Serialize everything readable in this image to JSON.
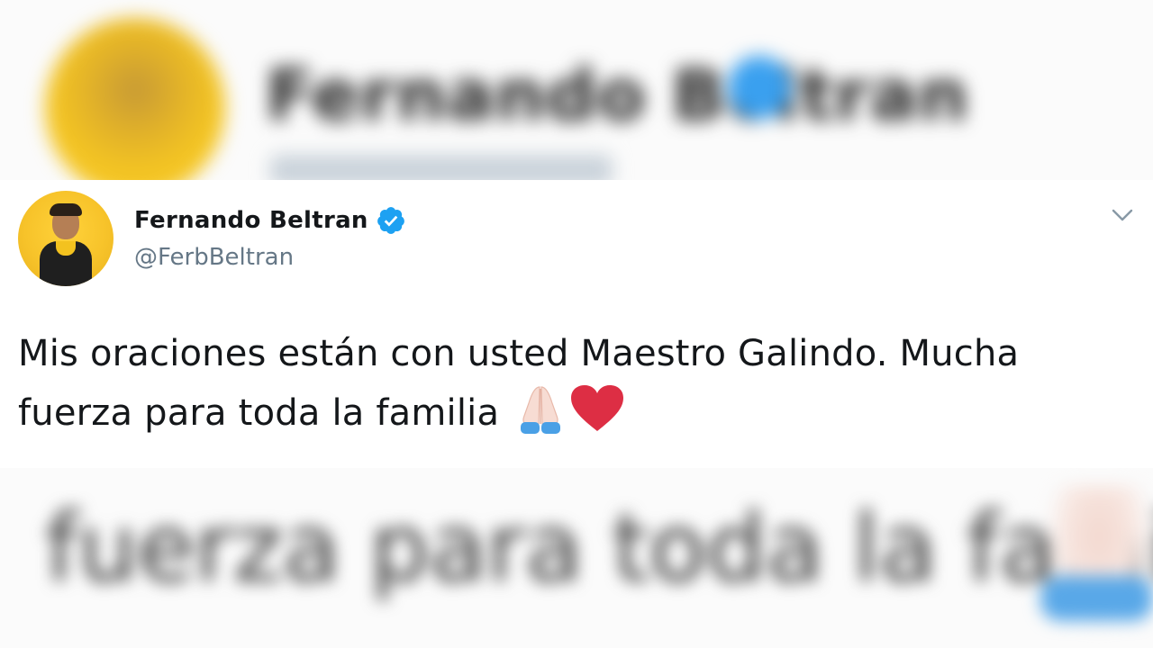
{
  "background": {
    "top_name": "Fernando Beltran",
    "bottom_text": "fuerza para toda la familia"
  },
  "tweet": {
    "display_name": "Fernando Beltran",
    "handle": "@FerbBeltran",
    "verified": true,
    "text_line1": "Mis oraciones están con usted Maestro Galindo. Mucha",
    "text_line2": "fuerza para toda la familia",
    "emojis": [
      "folded-hands-icon",
      "red-heart-icon"
    ]
  },
  "colors": {
    "verified_blue": "#1da1f2",
    "heart_red": "#dd2e44",
    "handle_gray": "#657786",
    "avatar_yellow": "#f7c32a"
  }
}
